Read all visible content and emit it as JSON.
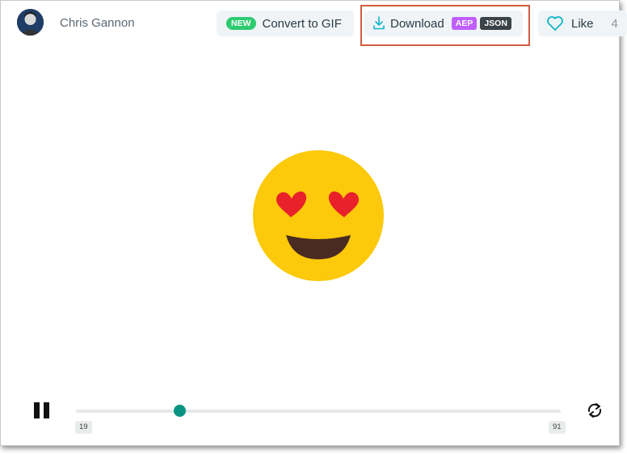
{
  "header": {
    "author_name": "Chris Gannon",
    "new_badge": "NEW",
    "convert_gif_label": "Convert to GIF",
    "download_label": "Download",
    "download_formats": [
      "AEP",
      "JSON"
    ],
    "like_label": "Like",
    "like_count": "4"
  },
  "player": {
    "start_frame": "19",
    "end_frame": "91",
    "progress_fraction": 0.215
  },
  "colors": {
    "new_badge": "#2ecb71",
    "aep_tag": "#c05ffd",
    "json_tag": "#394349",
    "highlight_border": "#d15b3e",
    "accent_knob": "#0a9381",
    "emoji_face": "#fcc90b",
    "emoji_hearts": "#e8212b",
    "emoji_mouth": "#4a2b22"
  },
  "icons": [
    "avatar",
    "download-icon",
    "heart-outline-icon",
    "pause-icon",
    "loop-icon"
  ]
}
